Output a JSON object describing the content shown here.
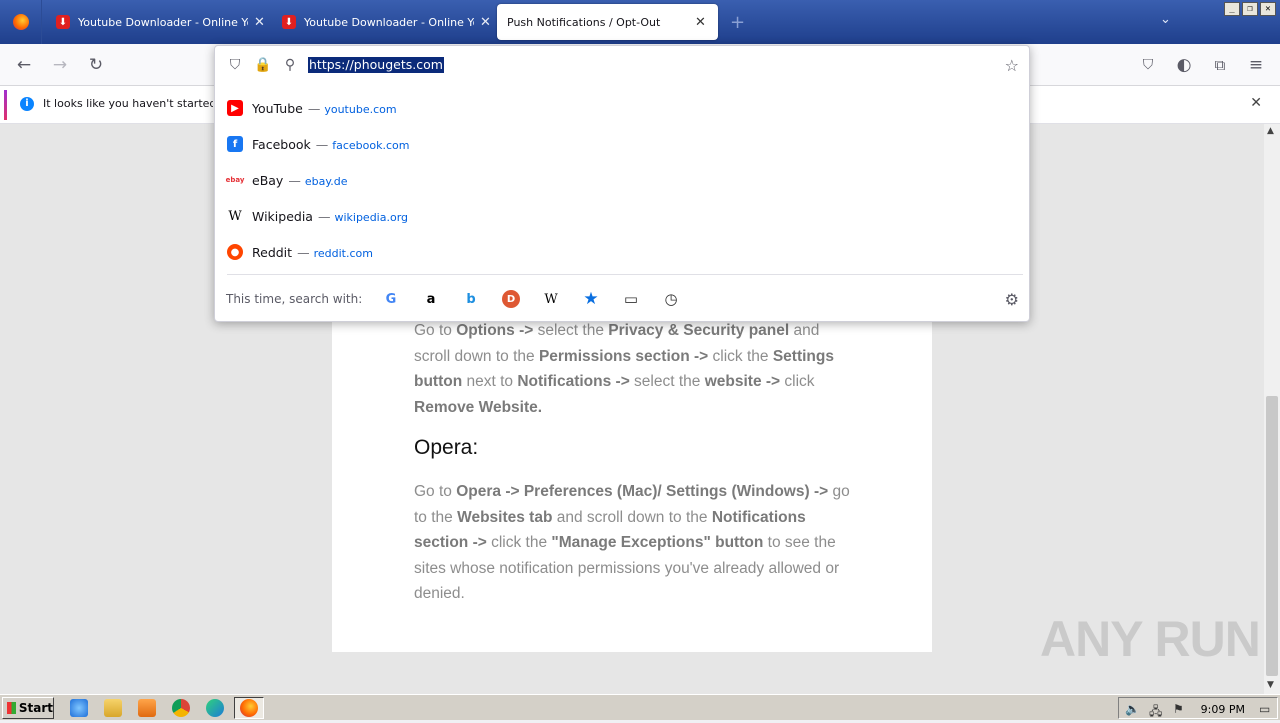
{
  "tabs": [
    {
      "title": "Youtube Downloader - Online Youtube Video Downloader",
      "close": "✕"
    },
    {
      "title": "Youtube Downloader - Online Youtube Video Downloader",
      "close": "✕"
    },
    {
      "title": "Push Notifications / Opt-Out",
      "close": "✕",
      "active": true
    }
  ],
  "window_buttons": {
    "minimize": "_",
    "restore": "❐",
    "close": "✕"
  },
  "urlbar": {
    "value": "https://phougets.com"
  },
  "notification": {
    "text": "It looks like you haven't started Firefox in a while."
  },
  "suggestions": [
    {
      "name": "YouTube",
      "host": "youtube.com",
      "icon": "youtube-icon",
      "color": "#ff0000"
    },
    {
      "name": "Facebook",
      "host": "facebook.com",
      "icon": "facebook-icon",
      "color": "#1877f2"
    },
    {
      "name": "eBay",
      "host": "ebay.de",
      "icon": "ebay-icon",
      "color": "#e53238"
    },
    {
      "name": "Wikipedia",
      "host": "wikipedia.org",
      "icon": "wikipedia-icon",
      "color": "#000000"
    },
    {
      "name": "Reddit",
      "host": "reddit.com",
      "icon": "reddit-icon",
      "color": "#ff4500"
    }
  ],
  "search_with_label": "This time, search with:",
  "separator": "—",
  "page": {
    "firefox_para": [
      "Go to ",
      "Options ->",
      " select the ",
      "Privacy & Security panel",
      " and scroll down to the ",
      "Permissions section ->",
      " click the ",
      "Settings button",
      " next to ",
      "Notifications ->",
      " select the ",
      "website ->",
      " click ",
      "Remove Website."
    ],
    "opera_heading": "Opera:",
    "opera_para": [
      "Go to ",
      "Opera -> Preferences (Mac)/ Settings (Windows) ->",
      " go to the ",
      "Websites tab",
      " and scroll down to the ",
      "Notifications section ->",
      " click the ",
      "\"Manage Exceptions\" button",
      " to see the sites whose notification permissions you've already allowed or denied."
    ]
  },
  "watermark": "ANY RUN",
  "taskbar": {
    "start": "Start",
    "clock": "9:09 PM"
  }
}
